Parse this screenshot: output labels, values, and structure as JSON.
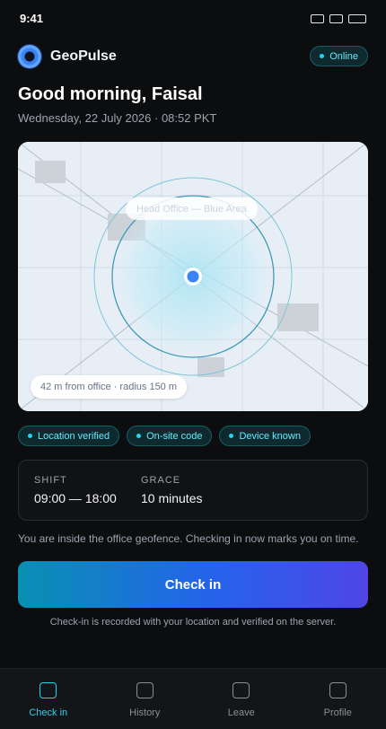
{
  "status_bar": {
    "time": "9:41"
  },
  "header": {
    "app_name": "GeoPulse",
    "status": "Online"
  },
  "greeting": "Good morning, Faisal",
  "datetime": "Wednesday, 22 July 2026 · 08:52 PKT",
  "map": {
    "geofence_label": "Head Office — Blue Area",
    "distance_text": "42 m from office · radius 150 m",
    "distance_m": 42,
    "radius_m": 150
  },
  "verification_chips": [
    "Location verified",
    "On-site code",
    "Device known"
  ],
  "shift": {
    "shift_label": "SHIFT",
    "shift_value": "09:00 — 18:00",
    "grace_label": "GRACE",
    "grace_value": "10 minutes"
  },
  "info_text": "You are inside the office geofence. Checking in now marks you on time.",
  "checkin_button": "Check in",
  "footnote": "Check-in is recorded with your location and verified on the server.",
  "tabs": [
    {
      "label": "Check in",
      "icon": "checkin-icon",
      "active": true
    },
    {
      "label": "History",
      "icon": "history-icon",
      "active": false
    },
    {
      "label": "Leave",
      "icon": "leave-icon",
      "active": false
    },
    {
      "label": "Profile",
      "icon": "profile-icon",
      "active": false
    }
  ],
  "colors": {
    "accent": "#22d3ee",
    "background": "#0c0d0f",
    "button_start": "#0891b2",
    "button_end": "#4f46e5"
  }
}
